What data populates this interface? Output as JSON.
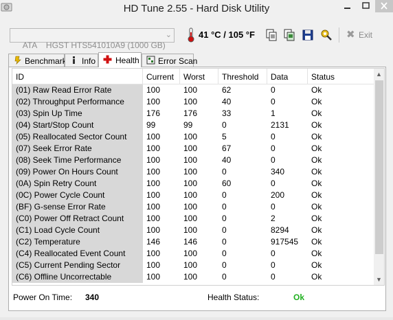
{
  "window": {
    "title": "HD Tune 2.55 - Hard Disk Utility"
  },
  "toolbar": {
    "drive": "ATA    HGST HTS541010A9 (1000 GB)",
    "temperature": "41 °C / 105 °F",
    "exit_label": "Exit",
    "icons": [
      "copy-text-icon",
      "copy-screenshot-icon",
      "save-icon",
      "options-icon",
      "exit-icon"
    ]
  },
  "tabs": [
    {
      "label": "Benchmark",
      "icon": "benchmark-icon"
    },
    {
      "label": "Info",
      "icon": "info-icon"
    },
    {
      "label": "Health",
      "icon": "health-cross-icon",
      "active": true
    },
    {
      "label": "Error Scan",
      "icon": "error-scan-icon"
    }
  ],
  "table": {
    "columns": [
      "ID",
      "Current",
      "Worst",
      "Threshold",
      "Data",
      "Status"
    ],
    "rows": [
      [
        "(01) Raw Read Error Rate",
        "100",
        "100",
        "62",
        "0",
        "Ok"
      ],
      [
        "(02) Throughput Performance",
        "100",
        "100",
        "40",
        "0",
        "Ok"
      ],
      [
        "(03) Spin Up Time",
        "176",
        "176",
        "33",
        "1",
        "Ok"
      ],
      [
        "(04) Start/Stop Count",
        "99",
        "99",
        "0",
        "2131",
        "Ok"
      ],
      [
        "(05) Reallocated Sector Count",
        "100",
        "100",
        "5",
        "0",
        "Ok"
      ],
      [
        "(07) Seek Error Rate",
        "100",
        "100",
        "67",
        "0",
        "Ok"
      ],
      [
        "(08) Seek Time Performance",
        "100",
        "100",
        "40",
        "0",
        "Ok"
      ],
      [
        "(09) Power On Hours Count",
        "100",
        "100",
        "0",
        "340",
        "Ok"
      ],
      [
        "(0A) Spin Retry Count",
        "100",
        "100",
        "60",
        "0",
        "Ok"
      ],
      [
        "(0C) Power Cycle Count",
        "100",
        "100",
        "0",
        "200",
        "Ok"
      ],
      [
        "(BF) G-sense Error Rate",
        "100",
        "100",
        "0",
        "0",
        "Ok"
      ],
      [
        "(C0) Power Off Retract Count",
        "100",
        "100",
        "0",
        "2",
        "Ok"
      ],
      [
        "(C1) Load Cycle Count",
        "100",
        "100",
        "0",
        "8294",
        "Ok"
      ],
      [
        "(C2) Temperature",
        "146",
        "146",
        "0",
        "917545",
        "Ok"
      ],
      [
        "(C4) Reallocated Event Count",
        "100",
        "100",
        "0",
        "0",
        "Ok"
      ],
      [
        "(C5) Current Pending Sector",
        "100",
        "100",
        "0",
        "0",
        "Ok"
      ],
      [
        "(C6) Offline Uncorrectable",
        "100",
        "100",
        "0",
        "0",
        "Ok"
      ]
    ]
  },
  "status": {
    "power_on_label": "Power On Time:",
    "power_on_value": "340",
    "health_label": "Health Status:",
    "health_value": "Ok",
    "health_color": "#20b020"
  }
}
